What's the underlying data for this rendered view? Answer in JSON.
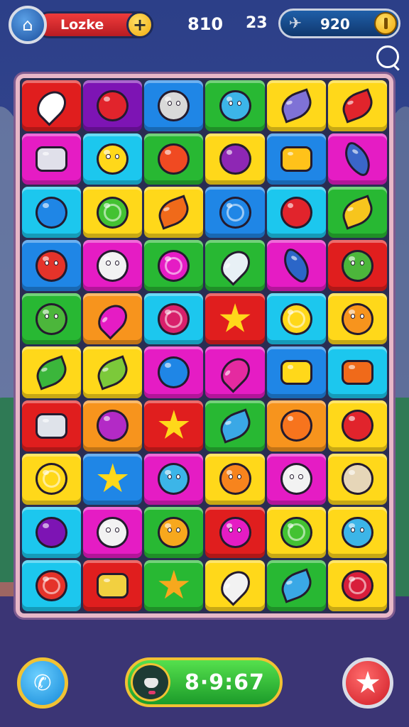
{
  "player": {
    "name": "Lozke",
    "add_label": "+"
  },
  "stats": {
    "score": "810",
    "moves": "23",
    "coins": "920"
  },
  "timer": {
    "value": "8·9:67"
  },
  "colors": {
    "red": "#e01e1e",
    "purple": "#7d14b4",
    "blue": "#1f86e6",
    "green": "#28b833",
    "yellow": "#ffd81a",
    "magenta": "#e51cc4",
    "cyan": "#1cc7ee",
    "orange": "#f7941d",
    "lightyellow": "#ffe23a"
  },
  "board": {
    "rows": [
      [
        {
          "bg": "red",
          "item": "radish",
          "shape": "drop",
          "color": "#ffffff"
        },
        {
          "bg": "purple",
          "item": "tomato",
          "shape": "round",
          "color": "#e1242c"
        },
        {
          "bg": "blue",
          "item": "cat-face",
          "shape": "round",
          "color": "#d9d9d9",
          "eyes": true
        },
        {
          "bg": "green",
          "item": "blue-monster",
          "shape": "round",
          "color": "#3cb5e8",
          "eyes": true
        },
        {
          "bg": "yellow",
          "item": "eggplant",
          "shape": "leaf",
          "color": "#7f72d6"
        },
        {
          "bg": "yellow",
          "item": "chili-pepper",
          "shape": "leaf",
          "color": "#e1242c"
        }
      ],
      [
        {
          "bg": "magenta",
          "item": "camera",
          "shape": "box",
          "color": "#e0e0ea"
        },
        {
          "bg": "cyan",
          "item": "yellow-fish",
          "shape": "round",
          "color": "#ffd81a",
          "eyes": true
        },
        {
          "bg": "green",
          "item": "apple",
          "shape": "round",
          "color": "#f04a22"
        },
        {
          "bg": "yellow",
          "item": "plum",
          "shape": "round",
          "color": "#8e27b4"
        },
        {
          "bg": "blue",
          "item": "pretzel",
          "shape": "box",
          "color": "#ffc21a"
        },
        {
          "bg": "magenta",
          "item": "music-note",
          "shape": "wedge",
          "color": "#3a66c8"
        }
      ],
      [
        {
          "bg": "cyan",
          "item": "blue-fish",
          "shape": "round",
          "color": "#1f86e6"
        },
        {
          "bg": "yellow",
          "item": "green-lollipop",
          "shape": "round",
          "color": "#43c232",
          "swirl": true
        },
        {
          "bg": "yellow",
          "item": "orange-leaf",
          "shape": "leaf",
          "color": "#f06a1a"
        },
        {
          "bg": "blue",
          "item": "blue-lollipop",
          "shape": "round",
          "color": "#1f86e6",
          "swirl": true
        },
        {
          "bg": "cyan",
          "item": "red-candy",
          "shape": "round",
          "color": "#e1242c"
        },
        {
          "bg": "green",
          "item": "mango",
          "shape": "leaf",
          "color": "#f7c51d"
        }
      ],
      [
        {
          "bg": "blue",
          "item": "red-crab",
          "shape": "round",
          "color": "#e5332a",
          "eyes": true
        },
        {
          "bg": "magenta",
          "item": "ghost",
          "shape": "round",
          "color": "#f2f2f2",
          "eyes": true
        },
        {
          "bg": "green",
          "item": "pink-lollipop",
          "shape": "round",
          "color": "#e51cc4",
          "swirl": true
        },
        {
          "bg": "green",
          "item": "ice-pop",
          "shape": "drop",
          "color": "#e8f0f5"
        },
        {
          "bg": "magenta",
          "item": "boot",
          "shape": "wedge",
          "color": "#2b66c8"
        },
        {
          "bg": "red",
          "item": "green-monster",
          "shape": "round",
          "color": "#4cb63b",
          "eyes": true
        }
      ],
      [
        {
          "bg": "green",
          "item": "green-slime",
          "shape": "round",
          "color": "#4cb63b",
          "eyes": true
        },
        {
          "bg": "orange",
          "item": "pink-jelly",
          "shape": "drop",
          "color": "#e51cc4"
        },
        {
          "bg": "cyan",
          "item": "red-donut",
          "shape": "round",
          "color": "#d8206b",
          "swirl": true
        },
        {
          "bg": "red",
          "item": "star",
          "shape": "star",
          "color": "#ffd81a"
        },
        {
          "bg": "cyan",
          "item": "compass",
          "shape": "round",
          "color": "#ffd81a",
          "swirl": true
        },
        {
          "bg": "yellow",
          "item": "orange-face",
          "shape": "round",
          "color": "#f7941d",
          "eyes": true
        }
      ],
      [
        {
          "bg": "yellow",
          "item": "green-feather",
          "shape": "leaf",
          "color": "#3bb63b"
        },
        {
          "bg": "yellow",
          "item": "green-leaf",
          "shape": "leaf",
          "color": "#7cc93a"
        },
        {
          "bg": "magenta",
          "item": "blue-berry",
          "shape": "round",
          "color": "#1f86e6"
        },
        {
          "bg": "magenta",
          "item": "pink-shell",
          "shape": "drop",
          "color": "#e52aa0"
        },
        {
          "bg": "blue",
          "item": "yellow-x",
          "shape": "box",
          "color": "#ffd81a"
        },
        {
          "bg": "cyan",
          "item": "toy-camera",
          "shape": "box",
          "color": "#f06a1a"
        }
      ],
      [
        {
          "bg": "red",
          "item": "silver-camera",
          "shape": "box",
          "color": "#dfe3ea"
        },
        {
          "bg": "orange",
          "item": "purple-bean",
          "shape": "round",
          "color": "#b32ac6"
        },
        {
          "bg": "red",
          "item": "yellow-star",
          "shape": "star",
          "color": "#ffd81a"
        },
        {
          "bg": "green",
          "item": "blue-bottle",
          "shape": "leaf",
          "color": "#3aa8e6"
        },
        {
          "bg": "orange",
          "item": "orange-fruit",
          "shape": "round",
          "color": "#f7741d"
        },
        {
          "bg": "yellow",
          "item": "red-lollipop",
          "shape": "round",
          "color": "#e1242c"
        }
      ],
      [
        {
          "bg": "yellow",
          "item": "green-eye",
          "shape": "round",
          "color": "#ffd81a",
          "swirl": true
        },
        {
          "bg": "blue",
          "item": "yellow-star-face",
          "shape": "star",
          "color": "#ffd81a"
        },
        {
          "bg": "magenta",
          "item": "blue-face",
          "shape": "round",
          "color": "#3cb5e8",
          "eyes": true
        },
        {
          "bg": "yellow",
          "item": "orange-monster",
          "shape": "round",
          "color": "#f7841d",
          "eyes": true
        },
        {
          "bg": "magenta",
          "item": "white-cat",
          "shape": "round",
          "color": "#f2f2f2",
          "eyes": true
        },
        {
          "bg": "yellow",
          "item": "striped-egg",
          "shape": "round",
          "color": "#e6d6b8"
        }
      ],
      [
        {
          "bg": "cyan",
          "item": "purple-eggplant",
          "shape": "round",
          "color": "#7d14b4"
        },
        {
          "bg": "magenta",
          "item": "white-ghost",
          "shape": "round",
          "color": "#f2f2f2",
          "eyes": true
        },
        {
          "bg": "green",
          "item": "orange-cat",
          "shape": "round",
          "color": "#f7a81d",
          "eyes": true
        },
        {
          "bg": "red",
          "item": "pink-monster",
          "shape": "round",
          "color": "#e51cc4",
          "eyes": true
        },
        {
          "bg": "yellow",
          "item": "green-swirl",
          "shape": "round",
          "color": "#43c232",
          "swirl": true
        },
        {
          "bg": "yellow",
          "item": "blue-bird",
          "shape": "round",
          "color": "#3cb5e8",
          "eyes": true
        }
      ],
      [
        {
          "bg": "cyan",
          "item": "red-snail",
          "shape": "round",
          "color": "#e5332a",
          "swirl": true
        },
        {
          "bg": "red",
          "item": "tube",
          "shape": "box",
          "color": "#f2d040"
        },
        {
          "bg": "green",
          "item": "orange-cat-face",
          "shape": "star",
          "color": "#f7a81d"
        },
        {
          "bg": "yellow",
          "item": "white-radish",
          "shape": "drop",
          "color": "#f2f2f2"
        },
        {
          "bg": "green",
          "item": "blue-rocket",
          "shape": "leaf",
          "color": "#3aa8e6"
        },
        {
          "bg": "yellow",
          "item": "red-berry",
          "shape": "round",
          "color": "#d81e3b",
          "swirl": true
        }
      ]
    ]
  },
  "icons": {
    "avatar": "player-avatar-icon",
    "coin": "gold-coin-icon",
    "rocket": "rocket-icon",
    "search": "search-icon",
    "call": "phone-icon",
    "star": "star-icon",
    "timer": "panda-face-icon"
  }
}
